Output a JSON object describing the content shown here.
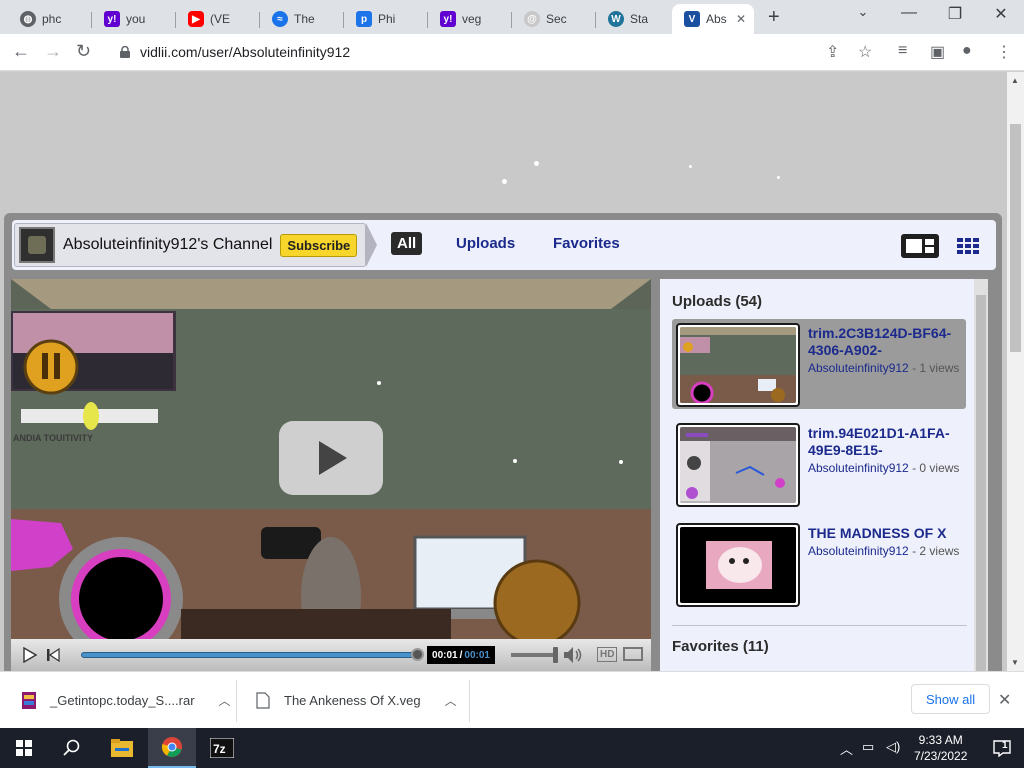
{
  "browser": {
    "tabs": [
      {
        "title": "phc",
        "favicon": "globe-icon",
        "color": "#5f6368"
      },
      {
        "title": "you",
        "favicon": "yahoo-icon",
        "color": "#6001d2"
      },
      {
        "title": "(VE",
        "favicon": "youtube-icon",
        "color": "#ff0000"
      },
      {
        "title": "The",
        "favicon": "chat-icon",
        "color": "#1a73e8"
      },
      {
        "title": "Phi",
        "favicon": "p-icon",
        "color": "#1d74e8"
      },
      {
        "title": "veg",
        "favicon": "yahoo-icon",
        "color": "#6001d2"
      },
      {
        "title": "Sec",
        "favicon": "spiral-icon",
        "color": "#a0a0a0"
      },
      {
        "title": "Sta",
        "favicon": "wordpress-icon",
        "color": "#21759b"
      },
      {
        "title": "Abs",
        "favicon": "vidlii-icon",
        "color": "#1b4fa0",
        "active": true
      }
    ],
    "url": "vidlii.com/user/Absoluteinfinity912"
  },
  "channel": {
    "name": "Absoluteinfinity912's Channel",
    "subscribe_label": "Subscribe",
    "nav": {
      "all": "All",
      "uploads": "Uploads",
      "favorites": "Favorites"
    }
  },
  "player": {
    "current_time": "00:01",
    "separator": "/",
    "duration": "00:01",
    "hd_label": "HD",
    "progress": 1.0
  },
  "sidebar": {
    "uploads_title": "Uploads (54)",
    "favorites_title": "Favorites (11)",
    "videos": [
      {
        "title": "trim.2C3B124D-BF64-4306-A902-",
        "author": "Absoluteinfinity912",
        "meta": " - 1 views",
        "selected": true
      },
      {
        "title": "trim.94E021D1-A1FA-49E9-8E15-",
        "author": "Absoluteinfinity912",
        "meta": " - 0 views",
        "selected": false
      },
      {
        "title": "THE MADNESS OF X",
        "author": "Absoluteinfinity912",
        "meta": " - 2 views",
        "selected": false
      }
    ]
  },
  "downloads": {
    "items": [
      {
        "name": "_Getintopc.today_S....rar"
      },
      {
        "name": "The Ankeness Of X.veg"
      }
    ],
    "show_all": "Show all"
  },
  "taskbar": {
    "time": "9:33 AM",
    "date": "7/23/2022",
    "notifications": "1"
  }
}
